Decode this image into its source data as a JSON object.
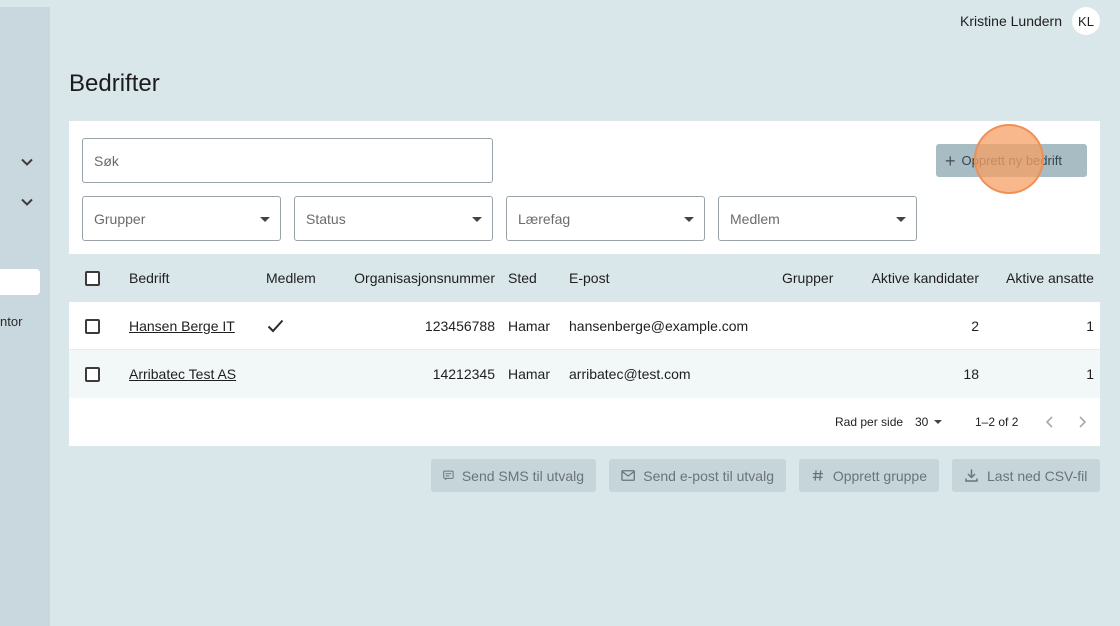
{
  "header": {
    "user_name": "Kristine Lundern",
    "user_initials": "KL"
  },
  "sidebar": {
    "partial_label": "ntor"
  },
  "page": {
    "title": "Bedrifter"
  },
  "filters": {
    "search_placeholder": "Søk",
    "selects": [
      "Grupper",
      "Status",
      "Lærefag",
      "Medlem"
    ],
    "create_label": "Opprett ny bedrift"
  },
  "table": {
    "headers": [
      "Bedrift",
      "Medlem",
      "Organisasjonsnummer",
      "Sted",
      "E-post",
      "Grupper",
      "Aktive kandidater",
      "Aktive ansatte"
    ],
    "rows": [
      {
        "bedrift": "Hansen Berge IT",
        "medlem": true,
        "orgnr": "123456788",
        "sted": "Hamar",
        "epost": "hansenberge@example.com",
        "grupper": "",
        "kandidater": "2",
        "ansatte": "1"
      },
      {
        "bedrift": "Arribatec Test AS",
        "medlem": false,
        "orgnr": "14212345",
        "sted": "Hamar",
        "epost": "arribatec@test.com",
        "grupper": "",
        "kandidater": "18",
        "ansatte": "1"
      }
    ]
  },
  "pagination": {
    "rows_per_page_label": "Rad per side",
    "rows_per_page": "30",
    "range": "1–2 of 2"
  },
  "actions": {
    "sms": "Send SMS til utvalg",
    "email": "Send e-post til utvalg",
    "group": "Opprett gruppe",
    "csv": "Last ned CSV-fil"
  },
  "colors": {
    "background": "#d9e6ea",
    "sidebar": "#c9d8de",
    "primary_button": "#a7bcc3",
    "click_indicator": "#f7a064"
  }
}
